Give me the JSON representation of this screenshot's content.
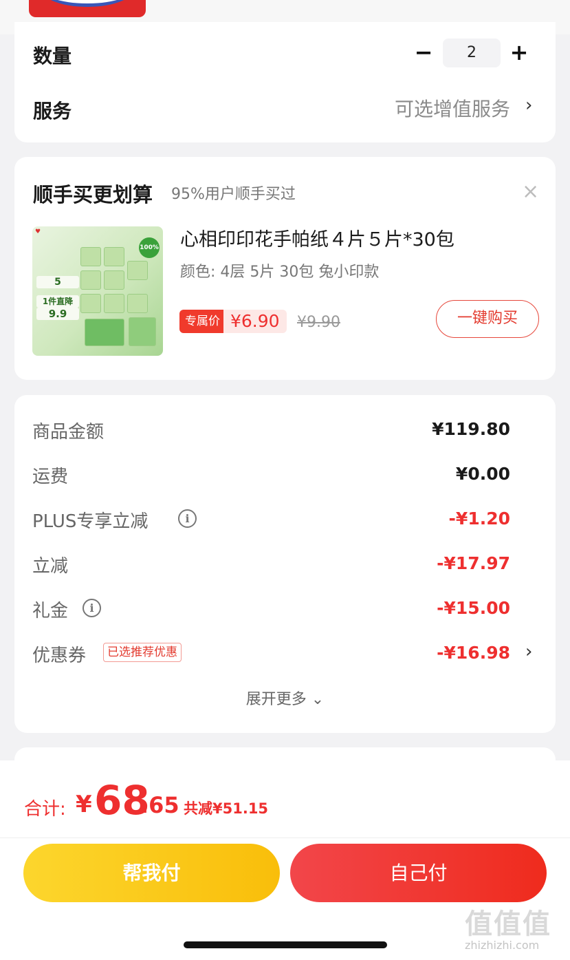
{
  "order": {
    "quantity_label": "数量",
    "quantity_value": "2",
    "minus_label": "−",
    "plus_label": "+",
    "service_label": "服务",
    "service_value": "可选增值服务",
    "chevron": "›"
  },
  "upsell": {
    "title": "顺手买更划算",
    "subtitle": "95%用户顺手买过",
    "close": "×",
    "product_name": "心相印印花手帕纸４片５片*30包",
    "product_spec": "颜色: 4层 5片 30包 兔小印款",
    "price_tag": "专属价",
    "price": "¥6.90",
    "original_price": "¥9.90",
    "buy_button": "一键购买",
    "image_texts": [
      "5",
      "1件直降",
      "9.9",
      "100%"
    ]
  },
  "summary": {
    "rows": [
      {
        "label": "商品金额",
        "value": "¥119.80"
      },
      {
        "label": "运费",
        "value": "¥0.00"
      },
      {
        "label": "PLUS专享立减",
        "value": "-¥1.20"
      },
      {
        "label": "立减",
        "value": "-¥17.97"
      },
      {
        "label": "礼金",
        "value": "-¥15.00"
      },
      {
        "label": "优惠券",
        "value": "-¥16.98"
      }
    ],
    "coupon_badge": "已选推荐优惠",
    "info_icon": "i",
    "expand": "展开更多 ⌄"
  },
  "footer": {
    "total_label": "合计:",
    "currency": "¥",
    "total_int": "68",
    "total_dec": ".65",
    "saved": "共减¥51.15",
    "help_pay": "帮我付",
    "self_pay": "自己付",
    "watermark_glyphs": "值值值",
    "watermark_site": "zhizhizhi.com"
  },
  "colors": {
    "accent_red": "#ee2f2f",
    "yellow_button": "#fbc515",
    "red_button": "#f03a2c",
    "background": "#f2f2f4"
  }
}
